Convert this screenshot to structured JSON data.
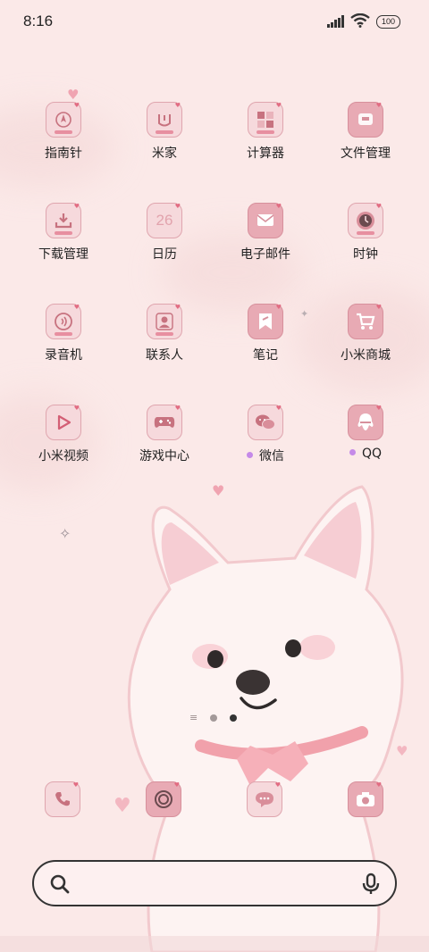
{
  "status_bar": {
    "time": "8:16",
    "battery": "100"
  },
  "apps": [
    {
      "label": "指南针",
      "icon": "compass-icon"
    },
    {
      "label": "米家",
      "icon": "mijia-icon"
    },
    {
      "label": "计算器",
      "icon": "calculator-icon"
    },
    {
      "label": "文件管理",
      "icon": "file-manager-icon"
    },
    {
      "label": "下载管理",
      "icon": "download-icon"
    },
    {
      "label": "日历",
      "icon": "calendar-icon",
      "badge": "26"
    },
    {
      "label": "电子邮件",
      "icon": "mail-icon"
    },
    {
      "label": "时钟",
      "icon": "clock-icon"
    },
    {
      "label": "录音机",
      "icon": "recorder-icon"
    },
    {
      "label": "联系人",
      "icon": "contacts-icon"
    },
    {
      "label": "笔记",
      "icon": "notes-icon"
    },
    {
      "label": "小米商城",
      "icon": "shop-cart-icon"
    },
    {
      "label": "小米视频",
      "icon": "video-play-icon"
    },
    {
      "label": "游戏中心",
      "icon": "gamepad-icon"
    },
    {
      "label": "微信",
      "icon": "wechat-icon"
    },
    {
      "label": "QQ",
      "icon": "qq-icon"
    }
  ],
  "dock": [
    {
      "icon": "phone-icon"
    },
    {
      "icon": "camera-lens-icon"
    },
    {
      "icon": "message-bubble-icon"
    },
    {
      "icon": "camera-icon"
    }
  ],
  "search": {
    "icon": "search-icon",
    "mic": "microphone-icon"
  },
  "colors": {
    "icon_fill": "#f6d9dc",
    "icon_stroke": "#dfa5ae",
    "accent": "#e78fa0",
    "new_dot": "#c58ae8"
  }
}
